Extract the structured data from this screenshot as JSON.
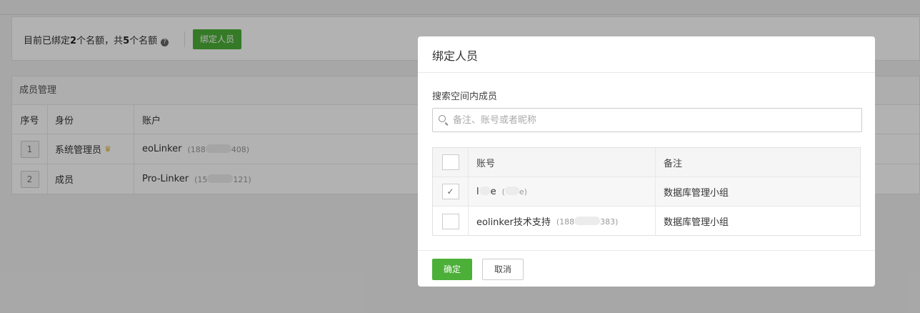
{
  "quota": {
    "prefix": "目前已绑定",
    "bound": "2",
    "mid": "个名额，共",
    "total": "5",
    "suffix": "个名额",
    "help_glyph": "?",
    "bind_button": "绑定人员"
  },
  "members": {
    "title": "成员管理",
    "columns": [
      "序号",
      "身份",
      "账户"
    ],
    "rows": [
      {
        "index": "1",
        "role": "系统管理员",
        "crown": "♛",
        "account": "eoLinker",
        "sub_prefix": "(188",
        "sub_suffix": "408)"
      },
      {
        "index": "2",
        "role": "成员",
        "crown": "",
        "account": "Pro-Linker",
        "sub_prefix": "(15",
        "sub_suffix": "121)"
      }
    ]
  },
  "modal": {
    "title": "绑定人员",
    "search_label": "搜索空间内成员",
    "search_value": "",
    "search_placeholder": "备注、账号或者昵称",
    "columns": [
      "账号",
      "备注"
    ],
    "rows": [
      {
        "checked": true,
        "check_glyph": "✓",
        "account_a": "l",
        "account_b": "e",
        "sub_prefix": "(",
        "sub_suffix": "e)",
        "note": "数据库管理小组"
      },
      {
        "checked": false,
        "check_glyph": "",
        "account_a": "eolinker技术支持",
        "account_b": "",
        "sub_prefix": "(188",
        "sub_suffix": "383)",
        "note": "数据库管理小组"
      }
    ],
    "confirm_label": "确定",
    "cancel_label": "取消"
  },
  "colors": {
    "primary": "#4caf38",
    "crown": "#e0b03a"
  }
}
